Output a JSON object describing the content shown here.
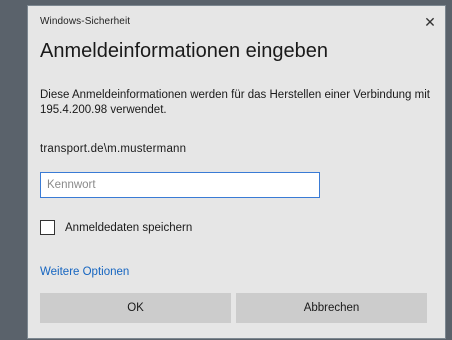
{
  "window": {
    "title": "Windows-Sicherheit",
    "close_glyph": "✕"
  },
  "dialog": {
    "heading": "Anmeldeinformationen eingeben",
    "description": "Diese Anmeldeinformationen werden für das Herstellen einer Verbindung mit 195.4.200.98 verwendet.",
    "username": "transport.de\\m.mustermann",
    "password_field": {
      "value": "",
      "placeholder": "Kennwort"
    },
    "remember_checkbox": {
      "label": "Anmeldedaten speichern",
      "checked": false
    },
    "more_options_link": "Weitere Optionen",
    "ok_label": "OK",
    "cancel_label": "Abbrechen"
  },
  "colors": {
    "dialog_background": "#e6e6e6",
    "link": "#1565c0",
    "focus_border": "#3a7bd5",
    "button": "#cccccc"
  }
}
